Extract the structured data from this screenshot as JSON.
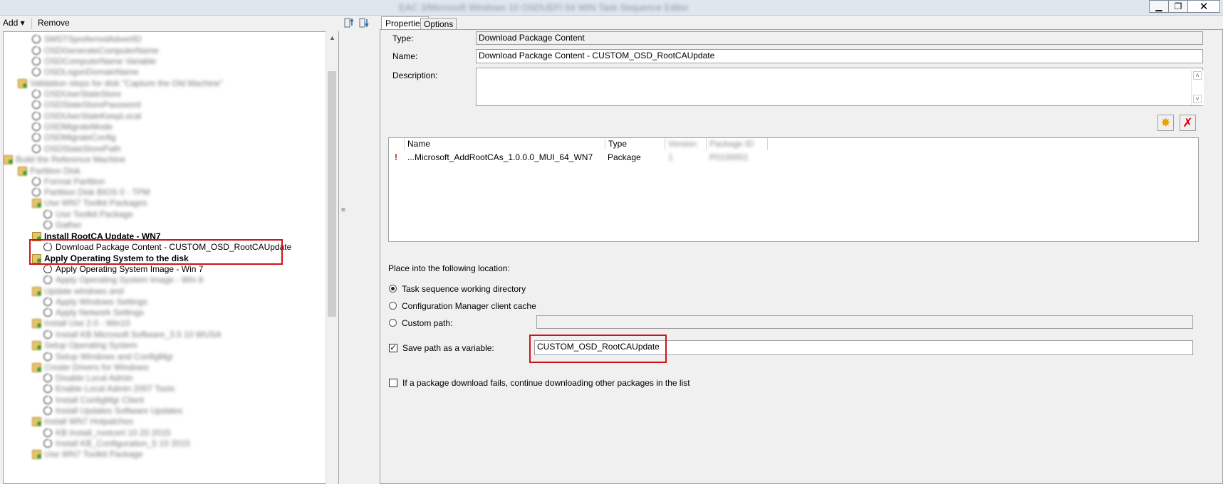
{
  "window": {
    "title": "EAC 3/Microsoft Windows 10 OSDUEFI 64 WIN Task Sequence Editor",
    "controls": {
      "minimize": "▁",
      "restore": "❐",
      "close": "✕"
    }
  },
  "toolbar": {
    "add_label": "Add ▾",
    "remove_label": "Remove"
  },
  "tree": {
    "scroll_up": "▲",
    "grip": "≡",
    "nodes": [
      {
        "text": "SMSTSpreferredAdvertID",
        "blur": true
      },
      {
        "text": "OSDGenerateComputerName",
        "blur": true
      },
      {
        "text": "OSDComputerName Variable",
        "blur": true
      },
      {
        "text": "OSDLogonDomainName",
        "blur": true
      },
      {
        "text": "Validation steps for disk \"Capture the Old Machine\"",
        "blur": true
      },
      {
        "text": "OSDUserStateStore",
        "blur": true
      },
      {
        "text": "OSDStateStorePassword",
        "blur": true
      },
      {
        "text": "OSDUserStateKeepLocal",
        "blur": true
      },
      {
        "text": "OSDMigrateMode",
        "blur": true
      },
      {
        "text": "OSDMigrateConfig",
        "blur": true
      },
      {
        "text": "OSDStateStorePath",
        "blur": true
      },
      {
        "text": "Build the Reference Machine",
        "blur": true
      },
      {
        "text": "Partition Disk",
        "blur": true
      },
      {
        "text": "Format Partition",
        "blur": true
      },
      {
        "text": "Partition Disk BIOS 0 - TPM",
        "blur": true
      },
      {
        "text": "Use WN7 Toolkit Packages",
        "blur": true
      },
      {
        "text": "Use Toolkit Package",
        "blur": true
      },
      {
        "text": "Gather",
        "blur": true
      },
      {
        "text": "Install RootCA Update - WN7",
        "blur": false,
        "bold": true
      },
      {
        "text": "Download Package Content - CUSTOM_OSD_RootCAUpdate",
        "blur": false
      },
      {
        "text": "Apply Operating System to the disk",
        "blur": false,
        "bold": true
      },
      {
        "text": "Apply Operating System Image - Win 7",
        "blur": false
      },
      {
        "text": "Apply Operating System Image - Win 8",
        "blur": true
      },
      {
        "text": "Update windows and",
        "blur": true
      },
      {
        "text": "Apply Windows Settings",
        "blur": true
      },
      {
        "text": "Apply Network Settings",
        "blur": true
      },
      {
        "text": "Install Use 2.0 - Win10",
        "blur": true
      },
      {
        "text": "Install KB Microsoft Software_3.5 10 WUSA",
        "blur": true
      },
      {
        "text": "Setup Operating System",
        "blur": true
      },
      {
        "text": "Setup Windows and ConfigMgr",
        "blur": true
      },
      {
        "text": "Create Drivers for Windows",
        "blur": true
      },
      {
        "text": "Disable Local Admin",
        "blur": true
      },
      {
        "text": "Enable Local Admin 2007 Tools",
        "blur": true
      },
      {
        "text": "Install ConfigMgr Client",
        "blur": true
      },
      {
        "text": "Install Updates Software Updates",
        "blur": true
      },
      {
        "text": "Install WN7 Hotpatches",
        "blur": true
      },
      {
        "text": "KB Install_rootcert 10 20 2015",
        "blur": true
      },
      {
        "text": "Install KB_Configuration_5 10 2015",
        "blur": true
      },
      {
        "text": "Use WN7 Toolkit Package",
        "blur": true
      }
    ]
  },
  "tabs": {
    "properties": "Properties",
    "options": "Options"
  },
  "form": {
    "type_label": "Type:",
    "type_value": "Download Package Content",
    "name_label": "Name:",
    "name_value": "Download Package Content - CUSTOM_OSD_RootCAUpdate",
    "description_label": "Description:",
    "description_value": "",
    "scroll_up": "˄",
    "scroll_down": "˅"
  },
  "pkg_buttons": {
    "new": "✸",
    "delete": "✗"
  },
  "pkg_table": {
    "columns": [
      {
        "label": "Name",
        "blur": false
      },
      {
        "label": "Type",
        "blur": false
      },
      {
        "label": "Version",
        "blur": true
      },
      {
        "label": "Package ID",
        "blur": true
      }
    ],
    "rows": [
      {
        "marker": "!",
        "name": "...Microsoft_AddRootCAs_1.0.0.0_MUI_64_WN7",
        "type": "Package",
        "version": "1",
        "package_id": "P0100001"
      }
    ]
  },
  "location": {
    "heading": "Place into the following location:",
    "option_working_dir": "Task sequence working directory",
    "option_client_cache": "Configuration Manager client cache",
    "option_custom_path": "Custom path:",
    "custom_path_value": "",
    "selected": "Task sequence working directory"
  },
  "save_variable": {
    "label": "Save path as a variable:",
    "checked": true,
    "check_glyph": "✓",
    "value": "CUSTOM_OSD_RootCAUpdate"
  },
  "continue_on_fail": {
    "label": "If a package download fails, continue downloading other packages in the list",
    "checked": false
  }
}
